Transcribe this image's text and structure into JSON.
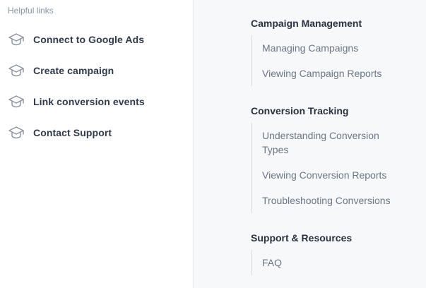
{
  "helpful_links": {
    "label": "Helpful links",
    "items": [
      {
        "label": "Connect to Google Ads",
        "icon": "graduation-cap-icon"
      },
      {
        "label": "Create campaign",
        "icon": "graduation-cap-icon"
      },
      {
        "label": "Link conversion events",
        "icon": "graduation-cap-icon"
      },
      {
        "label": "Contact Support",
        "icon": "graduation-cap-icon"
      }
    ]
  },
  "toc": {
    "sections": [
      {
        "title": "Campaign Management",
        "links": [
          "Managing Campaigns",
          "Viewing Campaign Reports"
        ]
      },
      {
        "title": "Conversion Tracking",
        "links": [
          "Understanding Conversion Types",
          "Viewing Conversion Reports",
          "Troubleshooting Conversions"
        ]
      },
      {
        "title": "Support & Resources",
        "links": [
          "FAQ"
        ]
      }
    ]
  },
  "colors": {
    "left_bg": "#ffffff",
    "right_bg": "#f7f8f9",
    "heading": "#2a3140",
    "link": "#6b7686",
    "muted": "#8a93a0",
    "divider": "#d3d7de"
  }
}
